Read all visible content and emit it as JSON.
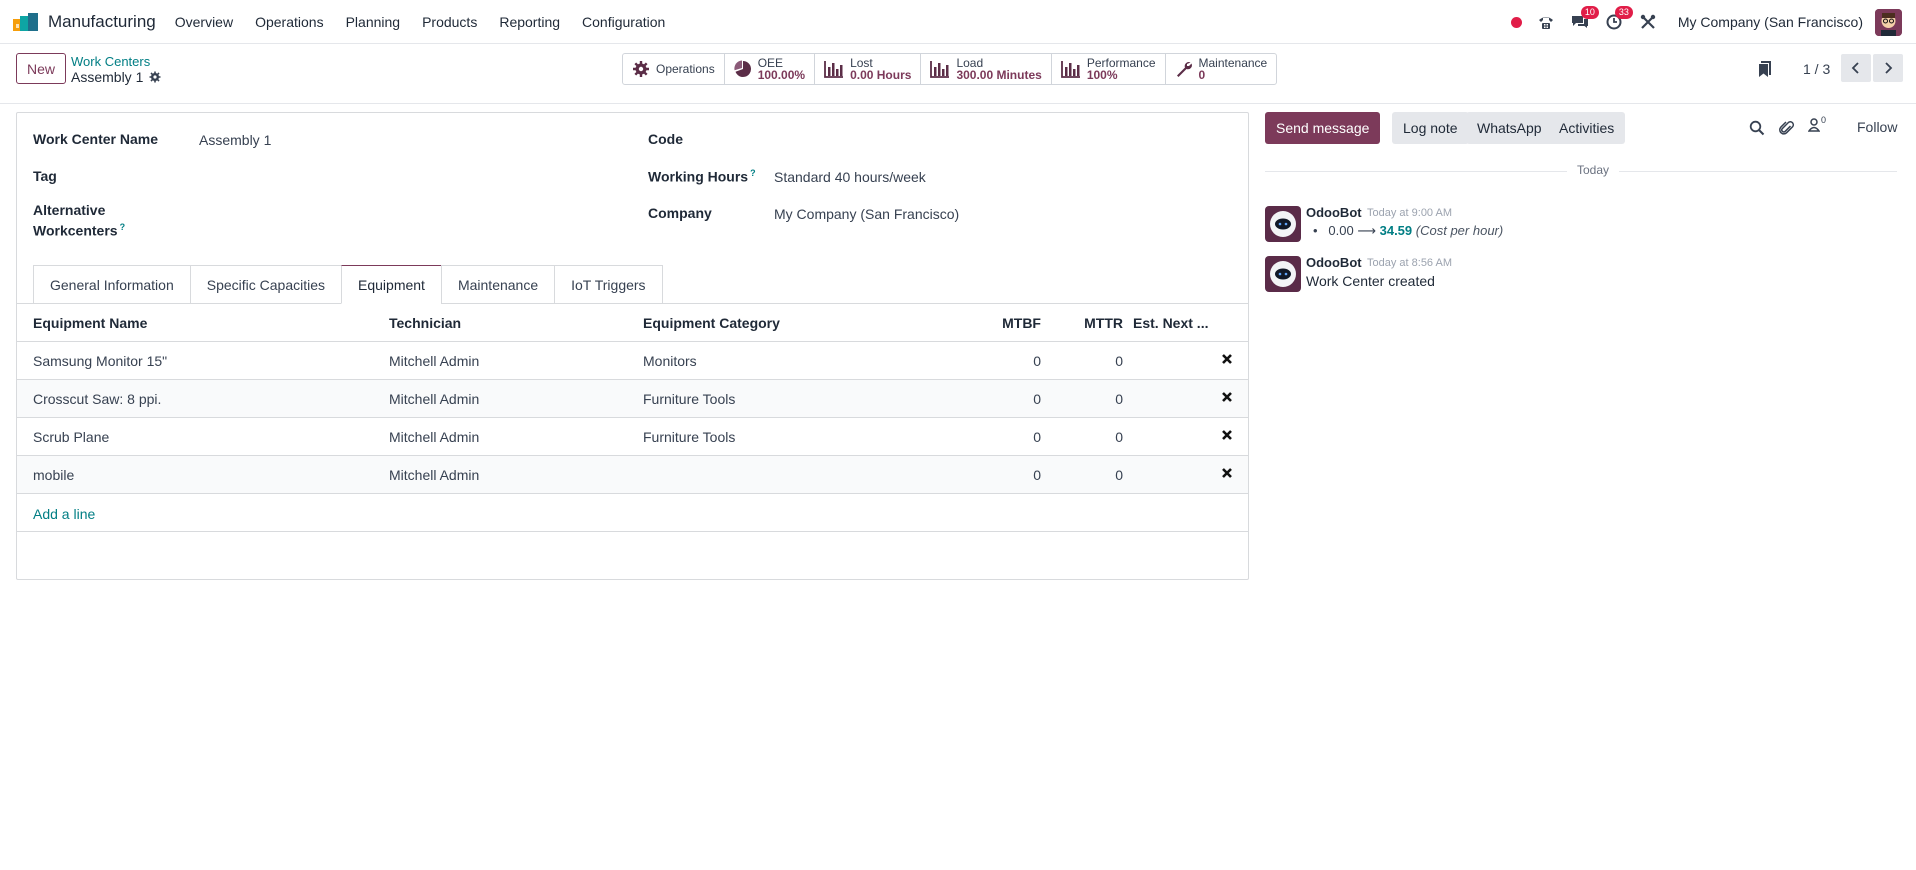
{
  "navbar": {
    "app_name": "Manufacturing",
    "menu": [
      "Overview",
      "Operations",
      "Planning",
      "Products",
      "Reporting",
      "Configuration"
    ],
    "messages_badge": "10",
    "activities_badge": "33",
    "company": "My Company (San Francisco)"
  },
  "control": {
    "new_label": "New",
    "breadcrumb_parent": "Work Centers",
    "breadcrumb_current": "Assembly 1",
    "stats": {
      "operations": "Operations",
      "oee_label": "OEE",
      "oee_value": "100.00%",
      "lost_label": "Lost",
      "lost_value": "0.00 Hours",
      "load_label": "Load",
      "load_value": "300.00 Minutes",
      "performance_label": "Performance",
      "performance_value": "100%",
      "maintenance_label": "Maintenance",
      "maintenance_value": "0"
    },
    "pager": "1 / 3"
  },
  "form": {
    "work_center_name_label": "Work Center Name",
    "work_center_name": "Assembly 1",
    "tag_label": "Tag",
    "alternative_label_1": "Alternative",
    "alternative_label_2": "Workcenters",
    "help_mark": "?",
    "code_label": "Code",
    "working_hours_label": "Working Hours",
    "working_hours": "Standard 40 hours/week",
    "company_label": "Company",
    "company": "My Company (San Francisco)",
    "tabs": [
      "General Information",
      "Specific Capacities",
      "Equipment",
      "Maintenance",
      "IoT Triggers"
    ],
    "active_tab": "Equipment"
  },
  "equipment": {
    "columns": [
      "Equipment Name",
      "Technician",
      "Equipment Category",
      "MTBF",
      "MTTR",
      "Est. Next ..."
    ],
    "rows": [
      {
        "name": "Samsung Monitor 15\"",
        "technician": "Mitchell Admin",
        "category": "Monitors",
        "mtbf": "0",
        "mttr": "0"
      },
      {
        "name": "Crosscut Saw: 8 ppi.",
        "technician": "Mitchell Admin",
        "category": "Furniture Tools",
        "mtbf": "0",
        "mttr": "0"
      },
      {
        "name": "Scrub Plane",
        "technician": "Mitchell Admin",
        "category": "Furniture Tools",
        "mtbf": "0",
        "mttr": "0"
      },
      {
        "name": "mobile",
        "technician": "Mitchell Admin",
        "category": "",
        "mtbf": "0",
        "mttr": "0"
      }
    ],
    "add_line": "Add a line"
  },
  "chatter": {
    "send_message": "Send message",
    "log_note": "Log note",
    "whatsapp": "WhatsApp",
    "activities": "Activities",
    "followers_count": "0",
    "follow": "Follow",
    "day": "Today",
    "messages": [
      {
        "author": "OdooBot",
        "time": "Today at 9:00 AM",
        "old_value": "0.00",
        "arrow": "⟶",
        "new_value": "34.59",
        "field": "(Cost per hour)"
      },
      {
        "author": "OdooBot",
        "time": "Today at 8:56 AM",
        "body": "Work Center created"
      }
    ]
  },
  "colors": {
    "primary": "#7c3a5a",
    "link": "#017e84",
    "badge": "#e11d48"
  }
}
